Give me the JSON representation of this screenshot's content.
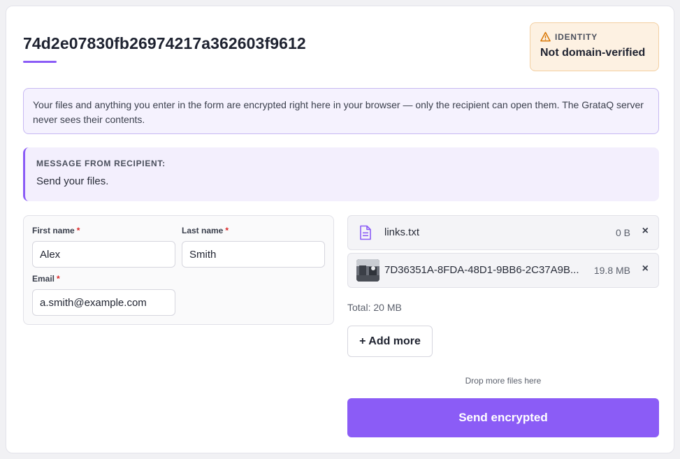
{
  "header": {
    "title": "74d2e07830fb26974217a362603f9612"
  },
  "identity": {
    "label": "IDENTITY",
    "status": "Not domain-verified",
    "icon": "warning-icon",
    "accent_color": "#d97706"
  },
  "notice": {
    "text": "Your files and anything you enter in the form are encrypted right here in your browser — only the recipient can open them. The GrataQ server never sees their contents."
  },
  "message": {
    "label": "MESSAGE FROM RECIPIENT:",
    "text": "Send your files."
  },
  "form": {
    "first_name": {
      "label": "First name",
      "required_mark": "*",
      "value": "Alex"
    },
    "last_name": {
      "label": "Last name",
      "required_mark": "*",
      "value": "Smith"
    },
    "email": {
      "label": "Email",
      "required_mark": "*",
      "value": "a.smith@example.com"
    }
  },
  "files": {
    "items": [
      {
        "name": "links.txt",
        "size": "0 B",
        "icon": "text-file-icon",
        "remove": "×"
      },
      {
        "name": "7D36351A-8FDA-48D1-9BB6-2C37A9B...",
        "size": "19.8 MB",
        "icon": "image-thumbnail",
        "remove": "×"
      }
    ],
    "total": "Total: 20 MB",
    "add_more_label": "+ Add more",
    "drop_hint": "Drop more files here"
  },
  "actions": {
    "send_label": "Send encrypted"
  },
  "colors": {
    "accent": "#8b5cf6",
    "warning_bg": "#fdf1e2",
    "required": "#dc2626"
  }
}
